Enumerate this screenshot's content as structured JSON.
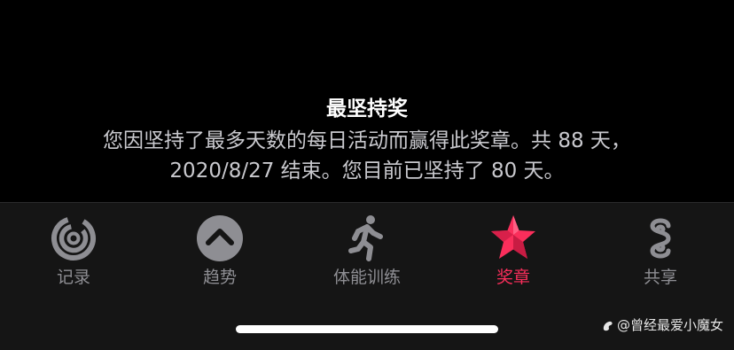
{
  "award": {
    "title": "最坚持奖",
    "description_line1": "您因坚持了最多天数的每日活动而赢得此奖章。共 88 天，",
    "description_line2": "2020/8/27 结束。您目前已坚持了 80 天。"
  },
  "tabbar": {
    "tabs": [
      {
        "label": "记录",
        "icon": "activity-rings-icon",
        "active": false
      },
      {
        "label": "趋势",
        "icon": "trends-chevron-icon",
        "active": false
      },
      {
        "label": "体能训练",
        "icon": "workout-runner-icon",
        "active": false
      },
      {
        "label": "奖章",
        "icon": "award-star-icon",
        "active": true
      },
      {
        "label": "共享",
        "icon": "sharing-icon",
        "active": false
      }
    ]
  },
  "colors": {
    "background": "#000000",
    "tabbar_background": "#151515",
    "inactive": "#8e8e93",
    "active": "#fa2e5b"
  },
  "watermark": {
    "text": "@曾经最爱小魔女"
  }
}
